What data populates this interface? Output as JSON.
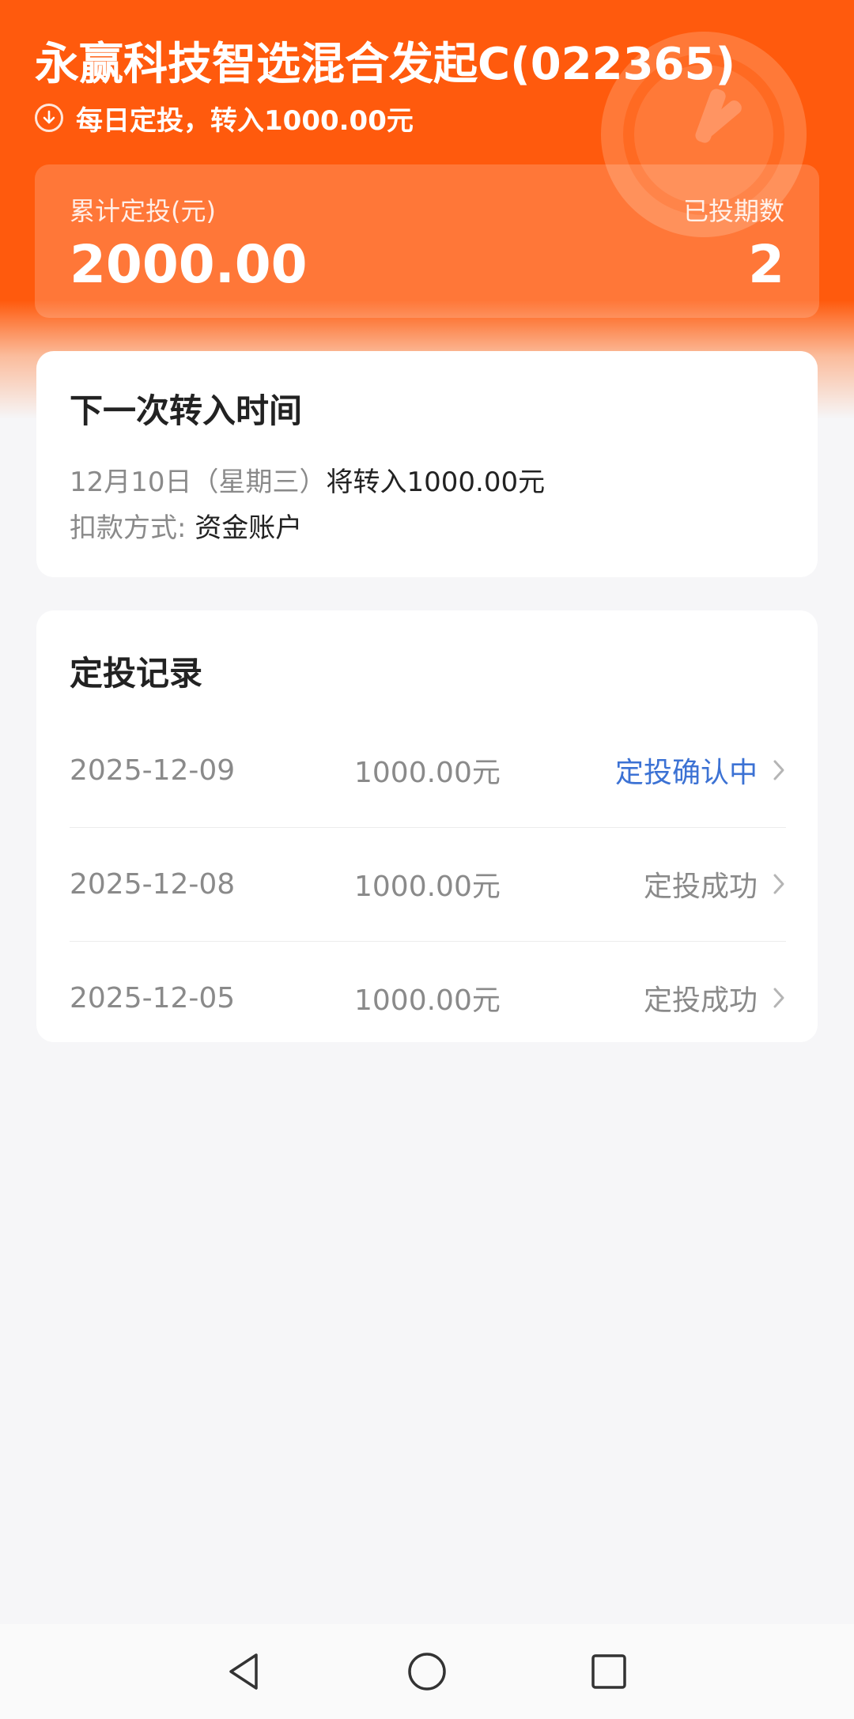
{
  "colors": {
    "brand_orange": "#ff5a0d",
    "pending_blue": "#3c72d4",
    "muted_text": "#8a8a8a",
    "page_bg": "#f6f6f8"
  },
  "header": {
    "fund_title": "永赢科技智选混合发起C(022365)",
    "plan_icon": "arrow-down-circle-icon",
    "plan_text": "每日定投，转入1000.00元"
  },
  "summary": {
    "cumulative_label": "累计定投(元)",
    "cumulative_value": "2000.00",
    "periods_label": "已投期数",
    "periods_value": "2"
  },
  "next_transfer": {
    "title": "下一次转入时间",
    "date_text": "12月10日（星期三）",
    "transfer_text": "将转入1000.00元",
    "payment_label": "扣款方式:",
    "payment_value": "资金账户"
  },
  "records": {
    "title": "定投记录",
    "items": [
      {
        "date": "2025-12-09",
        "amount": "1000.00元",
        "status": "定投确认中"
      },
      {
        "date": "2025-12-08",
        "amount": "1000.00元",
        "status": "定投成功"
      },
      {
        "date": "2025-12-05",
        "amount": "1000.00元",
        "status": "定投成功"
      }
    ]
  },
  "navbar": {
    "back_icon": "back-triangle-icon",
    "home_icon": "home-circle-icon",
    "recent_icon": "recent-apps-square-icon"
  }
}
